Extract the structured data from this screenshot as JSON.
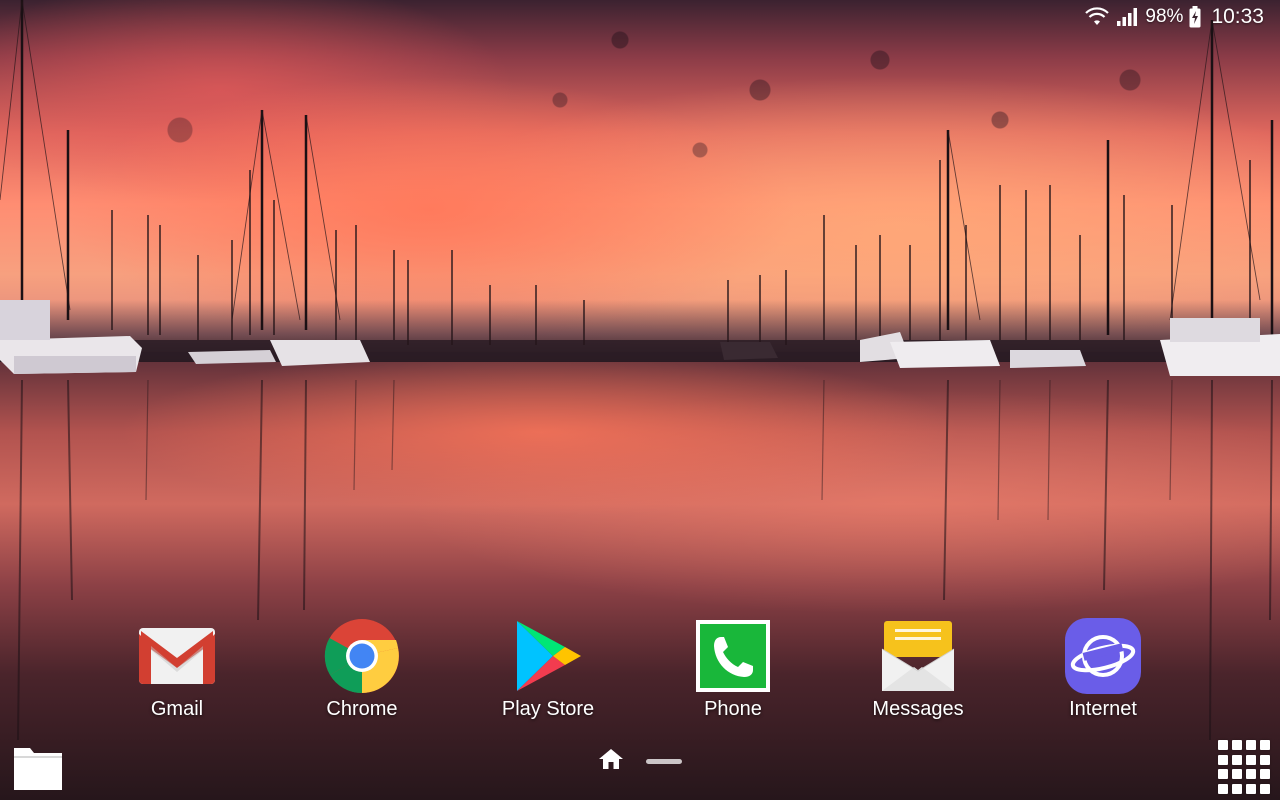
{
  "status_bar": {
    "battery_percent": "98%",
    "time": "10:33",
    "icons": [
      "wifi-icon",
      "signal-icon",
      "battery-charging-icon"
    ]
  },
  "dock": {
    "apps": [
      {
        "label": "Gmail",
        "icon": "gmail-icon"
      },
      {
        "label": "Chrome",
        "icon": "chrome-icon"
      },
      {
        "label": "Play Store",
        "icon": "play-store-icon"
      },
      {
        "label": "Phone",
        "icon": "phone-icon"
      },
      {
        "label": "Messages",
        "icon": "messages-icon"
      },
      {
        "label": "Internet",
        "icon": "internet-icon"
      }
    ]
  },
  "bottom_bar": {
    "left_icon": "folder-icon",
    "page_indicator_icon": "home-icon",
    "right_icon": "apps-grid-icon"
  },
  "wallpaper": {
    "description_colors": [
      "#e0685e",
      "#ff8d72",
      "#2a1a22"
    ]
  }
}
